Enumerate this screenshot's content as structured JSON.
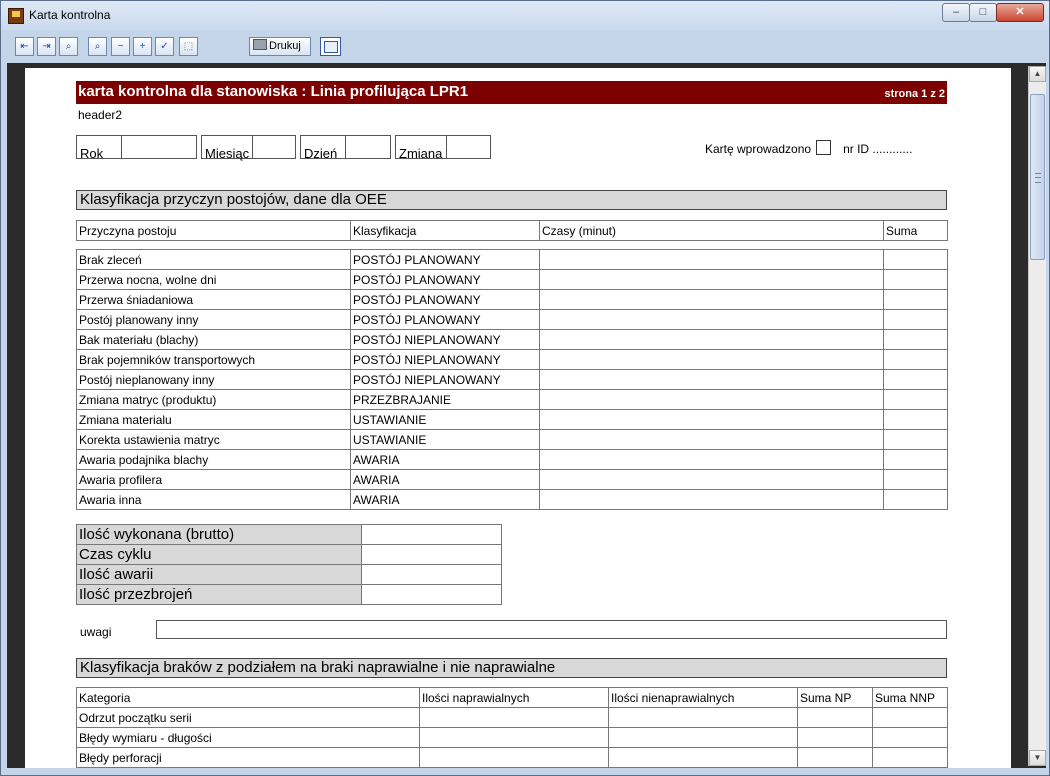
{
  "window": {
    "title": "Karta kontrolna",
    "minimize": "–",
    "maximize": "□",
    "close": "✕"
  },
  "toolbar": {
    "print_label": "Drukuj"
  },
  "report": {
    "title": "karta kontrolna dla stanowiska : Linia profilująca LPR1",
    "page_info": "strona 1 z 2",
    "header2": "header2",
    "date_fields": [
      "Rok",
      "Miesiąc",
      "Dzień",
      "Zmiana"
    ],
    "entered_label": "Kartę wprowadzono",
    "nr_id_label": "nr ID ............",
    "section1_title": "Klasyfikacja przyczyn postojów, dane dla OEE",
    "downtime_headers": [
      "Przyczyna postoju",
      "Klasyfikacja",
      "Czasy (minut)",
      "Suma"
    ],
    "downtime_rows": [
      [
        "Brak zleceń",
        "POSTÓJ PLANOWANY"
      ],
      [
        "Przerwa nocna, wolne dni",
        "POSTÓJ PLANOWANY"
      ],
      [
        "Przerwa śniadaniowa",
        "POSTÓJ PLANOWANY"
      ],
      [
        "Postój planowany inny",
        "POSTÓJ PLANOWANY"
      ],
      [
        "Bak materiału (blachy)",
        "POSTÓJ NIEPLANOWANY"
      ],
      [
        "Brak pojemników transportowych",
        "POSTÓJ NIEPLANOWANY"
      ],
      [
        "Postój nieplanowany inny",
        "POSTÓJ NIEPLANOWANY"
      ],
      [
        "Zmiana matryc (produktu)",
        "PRZEZBRAJANIE"
      ],
      [
        "Zmiana materialu",
        "USTAWIANIE"
      ],
      [
        "Korekta ustawienia matryc",
        "USTAWIANIE"
      ],
      [
        "Awaria podajnika blachy",
        "AWARIA"
      ],
      [
        "Awaria profilera",
        "AWARIA"
      ],
      [
        "Awaria inna",
        "AWARIA"
      ]
    ],
    "summary_rows": [
      "Ilość wykonana (brutto)",
      "Czas cyklu",
      "Ilość awarii",
      "Ilość przezbrojeń"
    ],
    "uwagi_label": "uwagi",
    "section2_title": "Klasyfikacja braków z podziałem na braki naprawialne i nie naprawialne",
    "defects_headers": [
      "Kategoria",
      "Ilości naprawialnych",
      "Ilości nienaprawialnych",
      "Suma NP",
      "Suma NNP"
    ],
    "defects_rows": [
      "Odrzut początku serii",
      "Błędy wymiaru - długości",
      "Błędy perforacji"
    ]
  }
}
